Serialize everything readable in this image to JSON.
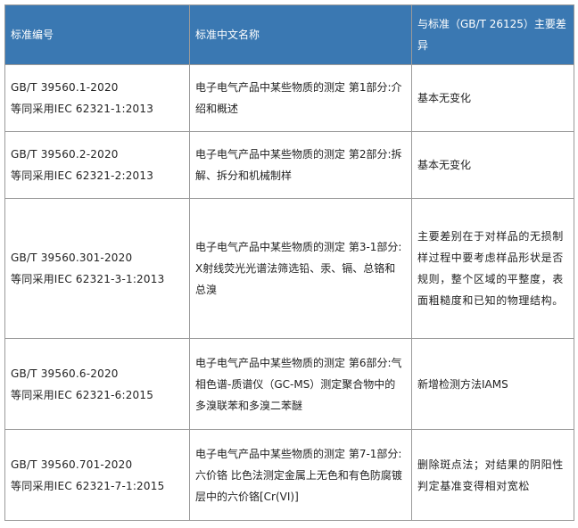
{
  "headers": [
    "标准编号",
    "标准中文名称",
    "与标准（GB/T 26125）主要差异"
  ],
  "rows": [
    {
      "code": "GB/T  39560.1-2020",
      "adopt": "等同采用IEC  62321-1:2013",
      "name": "电子电气产品中某些物质的测定 第1部分:介绍和概述",
      "diff": "基本无变化"
    },
    {
      "code": "GB/T  39560.2-2020",
      "adopt": "等同采用IEC  62321-2:2013",
      "name": "电子电气产品中某些物质的测定 第2部分:拆解、拆分和机械制样",
      "diff": "基本无变化"
    },
    {
      "code": "GB/T  39560.301-2020",
      "adopt": "等同采用IEC 62321-3-1:2013",
      "name": "电子电气产品中某些物质的测定 第3-1部分:X射线荧光光谱法筛选铅、汞、镉、总铬和总溴",
      "diff": "主要差别在于对样品的无损制样过程中要考虑样品形状是否规则，整个区域的平整度，表面粗糙度和已知的物理结构。"
    },
    {
      "code": "GB/T  39560.6-2020",
      "adopt": "等同采用IEC 62321-6:2015",
      "name": "电子电气产品中某些物质的测定 第6部分:气相色谱-质谱仪（GC-MS）测定聚合物中的多溴联苯和多溴二苯醚",
      "diff": "新增检测方法IAMS"
    },
    {
      "code": "GB/T  39560.701-2020",
      "adopt": "等同采用IEC 62321-7-1:2015",
      "name": "电子电气产品中某些物质的测定 第7-1部分:六价铬 比色法测定金属上无色和有色防腐镀层中的六价铬[Cr(VI)]",
      "diff": "删除斑点法；对结果的阴阳性判定基准变得相对宽松"
    }
  ]
}
